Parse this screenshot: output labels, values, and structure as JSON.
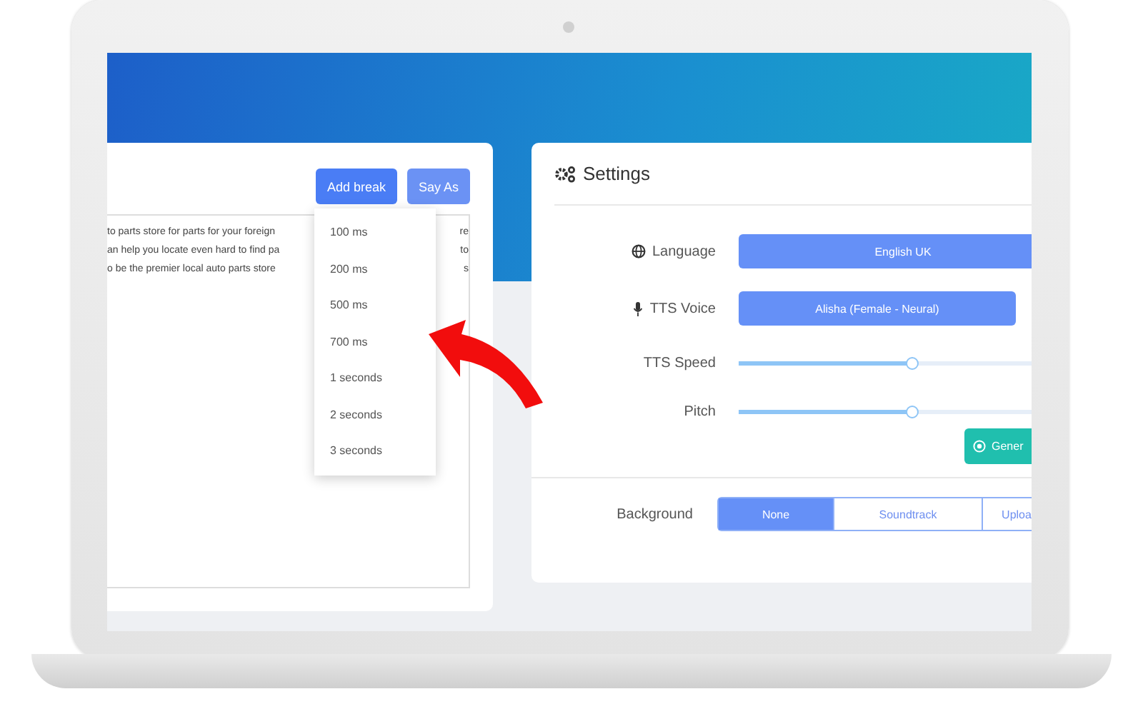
{
  "left_panel": {
    "buttons": [
      {
        "label": "Add break",
        "kind": "primary"
      },
      {
        "label": "Say As",
        "kind": "secondary"
      }
    ],
    "text_lines": [
      {
        "left": "to parts store for parts for your foreign",
        "right": "re"
      },
      {
        "left": "an help you locate even hard to find pa",
        "right": "to"
      },
      {
        "left": "o be the premier local auto parts store",
        "right": "s"
      }
    ],
    "break_menu": [
      "100 ms",
      "200 ms",
      "500 ms",
      "700 ms",
      "1 seconds",
      "2 seconds",
      "3 seconds"
    ]
  },
  "settings": {
    "title": "Settings",
    "language": {
      "label": "Language",
      "value": "English UK"
    },
    "tts_voice": {
      "label": "TTS Voice",
      "value": "Alisha (Female - Neural)"
    },
    "sliders": [
      {
        "label": "TTS Speed",
        "level": 0.59
      },
      {
        "label": "Pitch",
        "level": 0.59
      }
    ],
    "generate_button": "Gener",
    "background": {
      "label": "Background",
      "options": [
        {
          "label": "None",
          "selected": true
        },
        {
          "label": "Soundtrack",
          "selected": false
        },
        {
          "label": "Uploa",
          "selected": false
        }
      ]
    }
  }
}
